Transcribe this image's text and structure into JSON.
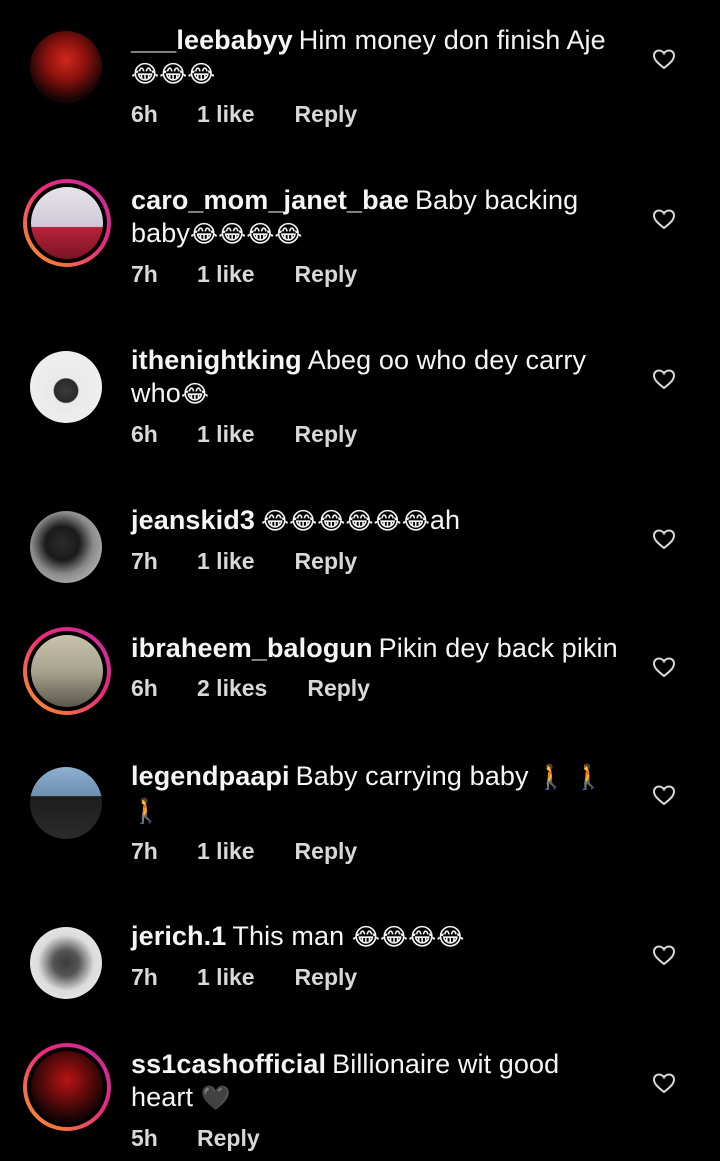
{
  "comments": [
    {
      "username": "___leebabyy",
      "text": "Him money don finish Aje",
      "emoji": "😂😂😂",
      "time": "6h",
      "likes": "1 like",
      "reply": "Reply",
      "ring": false,
      "avatar_colors": [
        "#3a0a0a",
        "#c0201b"
      ]
    },
    {
      "username": "caro_mom_janet_bae",
      "text": "Baby backing baby",
      "emoji": "😂😂😂😂",
      "time": "7h",
      "likes": "1 like",
      "reply": "Reply",
      "ring": true,
      "avatar_colors": [
        "#d9d4df",
        "#b8223a"
      ]
    },
    {
      "username": "ithenightking",
      "text": "Abeg oo who dey carry who",
      "emoji": "😂",
      "time": "6h",
      "likes": "1 like",
      "reply": "Reply",
      "ring": false,
      "avatar_colors": [
        "#e8e8e8",
        "#2a2a2a"
      ]
    },
    {
      "username": "jeanskid3",
      "text": "",
      "emoji": "😂😂😂😂😂😂",
      "text_after": "ah",
      "time": "7h",
      "likes": "1 like",
      "reply": "Reply",
      "ring": false,
      "avatar_colors": [
        "#bfbfbf",
        "#1c1c1c"
      ]
    },
    {
      "username": "ibraheem_balogun",
      "text": "Pikin dey back pikin",
      "emoji": "",
      "time": "6h",
      "likes": "2 likes",
      "reply": "Reply",
      "ring": true,
      "avatar_colors": [
        "#9c9682",
        "#3b3a33"
      ]
    },
    {
      "username": "legendpaapi",
      "text": "Baby carrying baby",
      "emoji": "🚶 🚶 🚶",
      "time": "7h",
      "likes": "1 like",
      "reply": "Reply",
      "ring": false,
      "avatar_colors": [
        "#6d8fb0",
        "#1d1d1d"
      ]
    },
    {
      "username": "jerich.1",
      "text": "This man",
      "emoji": "😂😂😂😂",
      "time": "7h",
      "likes": "1 like",
      "reply": "Reply",
      "ring": false,
      "avatar_colors": [
        "#dcdcdc",
        "#4a4a4a"
      ]
    },
    {
      "username": "ss1cashofficial",
      "text": "Billionaire wit good heart",
      "emoji": "🖤",
      "time": "5h",
      "likes": "",
      "reply": "Reply",
      "ring": true,
      "avatar_colors": [
        "#2a0606",
        "#b81414"
      ]
    }
  ],
  "colors": {
    "background": "#000000",
    "text": "#f5f5f5",
    "meta": "#d8d8d8",
    "heart_outline": "#d8d8d8",
    "story_ring_start": "#f9a020",
    "story_ring_end": "#c32aa3"
  },
  "icons": {
    "like": "heart-outline-icon"
  }
}
